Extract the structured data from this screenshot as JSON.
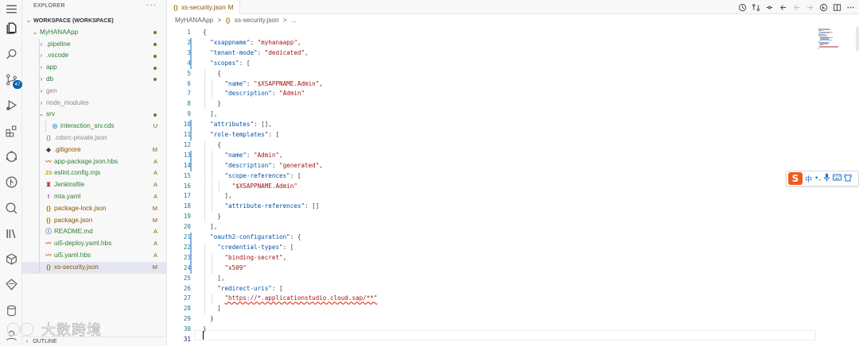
{
  "explorer": {
    "title": "EXPLORER",
    "more": "···",
    "outline_label": "OUTLINE",
    "tree": [
      {
        "name": "WORKSPACE (WORKSPACE)",
        "kind": "root",
        "status": ""
      },
      {
        "name": "MyHANAApp",
        "kind": "folder-open",
        "status": "dot"
      },
      {
        "name": ".pipeline",
        "kind": "folder",
        "status": "dot"
      },
      {
        "name": ".vscode",
        "kind": "folder",
        "status": "dot"
      },
      {
        "name": "app",
        "kind": "folder",
        "status": "dot"
      },
      {
        "name": "db",
        "kind": "folder",
        "status": "dot"
      },
      {
        "name": "gen",
        "kind": "folder-gray",
        "status": ""
      },
      {
        "name": "node_modules",
        "kind": "folder-gray",
        "status": ""
      },
      {
        "name": "srv",
        "kind": "folder-open",
        "status": "dot"
      },
      {
        "name": "interaction_srv.cds",
        "kind": "cds",
        "status": "U"
      },
      {
        "name": ".cdsrc-private.json",
        "kind": "json-gray",
        "status": ""
      },
      {
        "name": ".gitignore",
        "kind": "git",
        "status": "M"
      },
      {
        "name": "app-package.json.hbs",
        "kind": "hbs",
        "status": "A"
      },
      {
        "name": "eslint.config.mjs",
        "kind": "js",
        "status": "A"
      },
      {
        "name": "Jenkinsfile",
        "kind": "jenkins",
        "status": "A"
      },
      {
        "name": "mta.yaml",
        "kind": "yaml",
        "status": "A"
      },
      {
        "name": "package-lock.json",
        "kind": "json",
        "status": "M"
      },
      {
        "name": "package.json",
        "kind": "json",
        "status": "M"
      },
      {
        "name": "README.md",
        "kind": "md",
        "status": "A"
      },
      {
        "name": "ui5-deploy.yaml.hbs",
        "kind": "hbs",
        "status": "A"
      },
      {
        "name": "ui5.yaml.hbs",
        "kind": "hbs",
        "status": "A"
      },
      {
        "name": "xs-security.json",
        "kind": "json",
        "status": "M"
      }
    ]
  },
  "activity": {
    "scm_badge": "47",
    "icons": [
      "explorer-icon",
      "search-icon",
      "source-control-icon",
      "run-debug-icon",
      "extensions-icon",
      "remote-icon",
      "git-icon",
      "testing-icon",
      "library-icon",
      "cube-icon",
      "diamond-icon",
      "database-icon",
      "account-icon"
    ]
  },
  "editor": {
    "tab": {
      "icon": "{}",
      "name": "xs-security.json",
      "modified": "M"
    },
    "breadcrumb": {
      "folder": "MyHANAApp",
      "sep": ">",
      "file": "xs-security.json",
      "tail": "..."
    },
    "current_line": 31,
    "lines": [
      [
        [
          "p",
          "{"
        ]
      ],
      [
        [
          "p",
          "  "
        ],
        [
          "k",
          "\"xsappname\""
        ],
        [
          "p",
          ": "
        ],
        [
          "s",
          "\"myhanaapp\""
        ],
        [
          "p",
          ","
        ]
      ],
      [
        [
          "p",
          "  "
        ],
        [
          "k",
          "\"tenant-mode\""
        ],
        [
          "p",
          ": "
        ],
        [
          "s",
          "\"dedicated\""
        ],
        [
          "p",
          ","
        ]
      ],
      [
        [
          "p",
          "  "
        ],
        [
          "k",
          "\"scopes\""
        ],
        [
          "p",
          ": ["
        ]
      ],
      [
        [
          "p",
          "    {"
        ]
      ],
      [
        [
          "p",
          "      "
        ],
        [
          "k",
          "\"name\""
        ],
        [
          "p",
          ": "
        ],
        [
          "s",
          "\"$XSAPPNAME.Admin\""
        ],
        [
          "p",
          ","
        ]
      ],
      [
        [
          "p",
          "      "
        ],
        [
          "k",
          "\"description\""
        ],
        [
          "p",
          ": "
        ],
        [
          "s",
          "\"Admin\""
        ]
      ],
      [
        [
          "p",
          "    }"
        ]
      ],
      [
        [
          "p",
          "  ],"
        ]
      ],
      [
        [
          "p",
          "  "
        ],
        [
          "k",
          "\"attributes\""
        ],
        [
          "p",
          ": [],"
        ]
      ],
      [
        [
          "p",
          "  "
        ],
        [
          "k",
          "\"role-templates\""
        ],
        [
          "p",
          ": ["
        ]
      ],
      [
        [
          "p",
          "    {"
        ]
      ],
      [
        [
          "p",
          "      "
        ],
        [
          "k",
          "\"name\""
        ],
        [
          "p",
          ": "
        ],
        [
          "s",
          "\"Admin\""
        ],
        [
          "p",
          ","
        ]
      ],
      [
        [
          "p",
          "      "
        ],
        [
          "k",
          "\"description\""
        ],
        [
          "p",
          ": "
        ],
        [
          "s",
          "\"generated\""
        ],
        [
          "p",
          ","
        ]
      ],
      [
        [
          "p",
          "      "
        ],
        [
          "k",
          "\"scope-references\""
        ],
        [
          "p",
          ": ["
        ]
      ],
      [
        [
          "p",
          "        "
        ],
        [
          "s",
          "\"$XSAPPNAME.Admin\""
        ]
      ],
      [
        [
          "p",
          "      ],"
        ]
      ],
      [
        [
          "p",
          "      "
        ],
        [
          "k",
          "\"attribute-references\""
        ],
        [
          "p",
          ": []"
        ]
      ],
      [
        [
          "p",
          "    }"
        ]
      ],
      [
        [
          "p",
          "  ],"
        ]
      ],
      [
        [
          "p",
          "  "
        ],
        [
          "k",
          "\"oauth2-configuration\""
        ],
        [
          "p",
          ": {"
        ]
      ],
      [
        [
          "p",
          "    "
        ],
        [
          "k",
          "\"credential-types\""
        ],
        [
          "p",
          ": ["
        ]
      ],
      [
        [
          "p",
          "      "
        ],
        [
          "s",
          "\"binding-secret\""
        ],
        [
          "p",
          ","
        ]
      ],
      [
        [
          "p",
          "      "
        ],
        [
          "s",
          "\"x509\""
        ]
      ],
      [
        [
          "p",
          "    ],"
        ]
      ],
      [
        [
          "p",
          "    "
        ],
        [
          "k",
          "\"redirect-uris\""
        ],
        [
          "p",
          ": ["
        ]
      ],
      [
        [
          "p",
          "      "
        ],
        [
          "u",
          "\"https://*.applicationstudio.cloud.sap/**\""
        ]
      ],
      [
        [
          "p",
          "    ]"
        ]
      ],
      [
        [
          "p",
          "  }"
        ]
      ],
      [
        [
          "p",
          "}"
        ]
      ],
      [
        [
          "p",
          ""
        ]
      ]
    ]
  },
  "ime": {
    "logo": "S",
    "lang": "中",
    "punct": "•,",
    "voice": "mic-icon",
    "keyboard": "keyboard-icon"
  },
  "watermark": {
    "text": "大数跨境"
  },
  "colors": {
    "key": "#0451a5",
    "string": "#a31515",
    "modified": "#895503",
    "added": "#587c0c",
    "accent": "#005fb8"
  }
}
